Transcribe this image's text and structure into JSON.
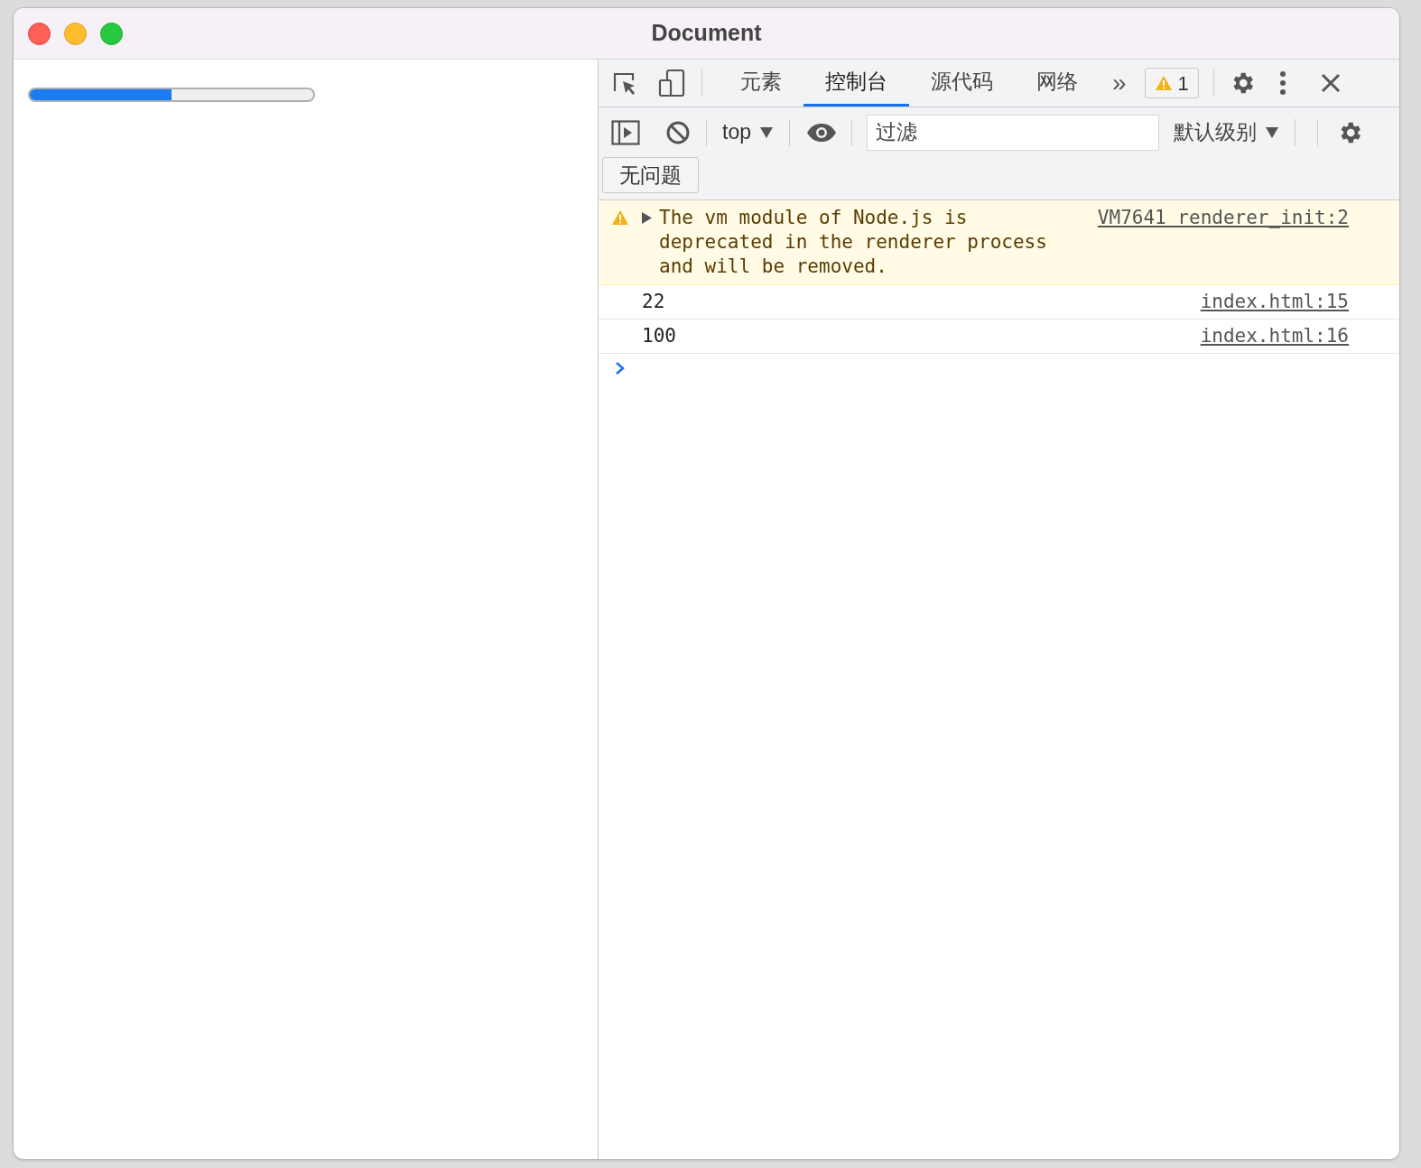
{
  "window": {
    "title": "Document"
  },
  "page": {
    "progress": {
      "level": 0.5
    }
  },
  "devtools": {
    "tabs": [
      {
        "label": "元素",
        "selected": false
      },
      {
        "label": "控制台",
        "selected": true
      },
      {
        "label": "源代码",
        "selected": false
      },
      {
        "label": "网络",
        "selected": false
      }
    ],
    "more_tabs": "»",
    "issues_badge": {
      "count": "1"
    },
    "console_toolbar": {
      "context": "top",
      "filter": {
        "placeholder": "过滤"
      },
      "levels": "默认级别"
    },
    "issues_button": "无问题",
    "messages": [
      {
        "kind": "warning",
        "text": "The vm module of Node.js is deprecated in the renderer process and will be removed.",
        "source": "VM7641 renderer_init:2"
      },
      {
        "kind": "log",
        "text": "22",
        "source": "index.html:15"
      },
      {
        "kind": "log",
        "text": "100",
        "source": "index.html:16"
      }
    ]
  }
}
